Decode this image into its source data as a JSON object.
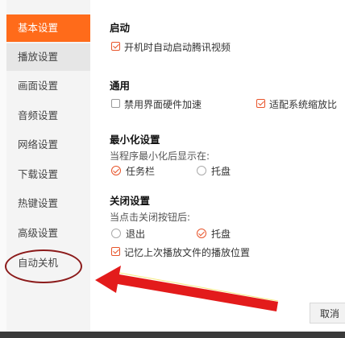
{
  "sidebar": {
    "items": [
      {
        "label": "基本设置",
        "state": "active"
      },
      {
        "label": "播放设置",
        "state": "hover"
      },
      {
        "label": "画面设置",
        "state": "normal"
      },
      {
        "label": "音频设置",
        "state": "normal"
      },
      {
        "label": "网络设置",
        "state": "normal"
      },
      {
        "label": "下载设置",
        "state": "normal"
      },
      {
        "label": "热键设置",
        "state": "normal"
      },
      {
        "label": "高级设置",
        "state": "normal"
      },
      {
        "label": "自动关机",
        "state": "normal"
      }
    ]
  },
  "startup": {
    "title": "启动",
    "autostart_label": "开机时自动启动腾讯视频",
    "autostart_checked": true
  },
  "general": {
    "title": "通用",
    "hw_accel_label": "禁用界面硬件加速",
    "hw_accel_checked": false,
    "scaling_label": "适配系统缩放比",
    "scaling_checked": true
  },
  "minimize": {
    "title": "最小化设置",
    "desc": "当程序最小化后显示在:",
    "option_taskbar": "任务栏",
    "option_tray": "托盘",
    "selected": "任务栏"
  },
  "close": {
    "title": "关闭设置",
    "desc": "当点击关闭按钮后:",
    "option_exit": "退出",
    "option_tray": "托盘",
    "selected": "托盘",
    "remember_label": "记忆上次播放文件的播放位置",
    "remember_checked": true
  },
  "footer": {
    "cancel_label": "取消"
  },
  "colors": {
    "accent": "#ff6b1a",
    "annotation_arrow": "#e31b1b",
    "annotation_ellipse": "#8b1a1a"
  }
}
